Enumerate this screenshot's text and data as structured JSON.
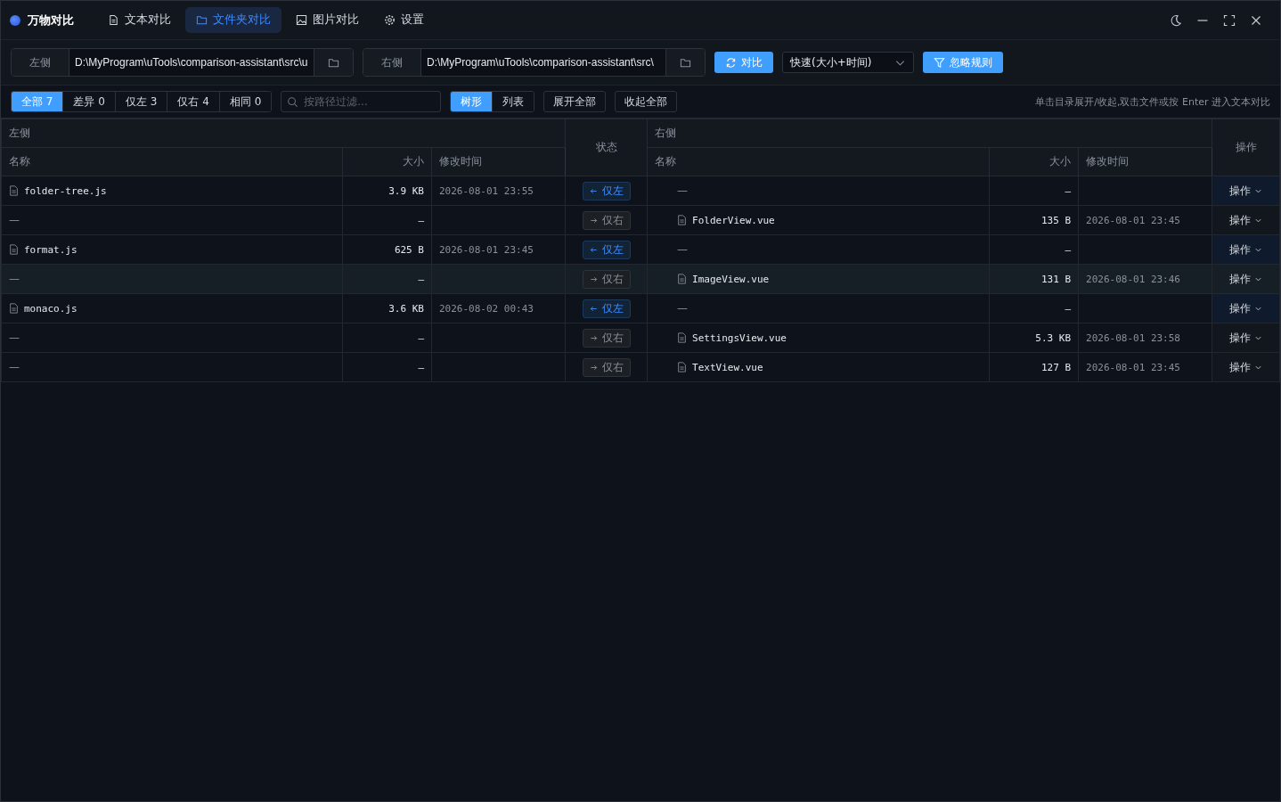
{
  "app": {
    "title": "万物对比"
  },
  "nav": [
    {
      "label": "文本对比",
      "selected": false
    },
    {
      "label": "文件夹对比",
      "selected": true
    },
    {
      "label": "图片对比",
      "selected": false
    },
    {
      "label": "设置",
      "selected": false
    }
  ],
  "paths": [
    {
      "label": "左侧",
      "value": "D:\\MyProgram\\uTools\\comparison-assistant\\src\\u"
    },
    {
      "label": "右侧",
      "value": "D:\\MyProgram\\uTools\\comparison-assistant\\src\\"
    }
  ],
  "compare_button": "对比",
  "mode_select": "快速(大小+时间)",
  "ignore_button": "忽略规则",
  "filters": [
    {
      "label": "全部 7",
      "selected": true
    },
    {
      "label": "差异 0",
      "selected": false
    },
    {
      "label": "仅左 3",
      "selected": false
    },
    {
      "label": "仅右 4",
      "selected": false
    },
    {
      "label": "相同 0",
      "selected": false
    }
  ],
  "search": {
    "placeholder": "按路径过滤..."
  },
  "views": [
    {
      "label": "树形",
      "selected": true
    },
    {
      "label": "列表",
      "selected": false
    }
  ],
  "expand_all": "展开全部",
  "collapse_all": "收起全部",
  "hint": "单击目录展开/收起,双击文件或按 Enter 进入文本对比",
  "table": {
    "left_group": "左侧",
    "right_group": "右侧",
    "status_header": "状态",
    "ops_header": "操作",
    "left_columns": [
      "名称",
      "大小",
      "修改时间"
    ],
    "right_columns": [
      "名称",
      "大小",
      "修改时间"
    ],
    "rows": [
      {
        "left": {
          "name": "folder-tree.js",
          "size": "3.9 KB",
          "time": "2026-08-01 23:55"
        },
        "status": {
          "kind": "left_only",
          "label": "仅左"
        },
        "right": {
          "name": "—",
          "size": "–"
        },
        "ops": "操作",
        "highlighted": false
      },
      {
        "left": {
          "name": "—",
          "size": "–"
        },
        "status": {
          "kind": "right_only",
          "label": "仅右"
        },
        "right": {
          "name": "FolderView.vue",
          "size": "135 B",
          "time": "2026-08-01 23:45"
        },
        "ops": "操作",
        "highlighted": false
      },
      {
        "left": {
          "name": "format.js",
          "size": "625 B",
          "time": "2026-08-01 23:45"
        },
        "status": {
          "kind": "left_only",
          "label": "仅左"
        },
        "right": {
          "name": "—",
          "size": "–"
        },
        "ops": "操作",
        "highlighted": false
      },
      {
        "left": {
          "name": "—",
          "size": "–"
        },
        "status": {
          "kind": "right_only",
          "label": "仅右"
        },
        "right": {
          "name": "ImageView.vue",
          "size": "131 B",
          "time": "2026-08-01 23:46"
        },
        "ops": "操作",
        "highlighted": true
      },
      {
        "left": {
          "name": "monaco.js",
          "size": "3.6 KB",
          "time": "2026-08-02 00:43"
        },
        "status": {
          "kind": "left_only",
          "label": "仅左"
        },
        "right": {
          "name": "—",
          "size": "–"
        },
        "ops": "操作",
        "highlighted": false
      },
      {
        "left": {
          "name": "—",
          "size": "–"
        },
        "status": {
          "kind": "right_only",
          "label": "仅右"
        },
        "right": {
          "name": "SettingsView.vue",
          "size": "5.3 KB",
          "time": "2026-08-01 23:58"
        },
        "ops": "操作",
        "highlighted": false
      },
      {
        "left": {
          "name": "—",
          "size": "–"
        },
        "status": {
          "kind": "right_only",
          "label": "仅右"
        },
        "right": {
          "name": "TextView.vue",
          "size": "127 B",
          "time": "2026-08-01 23:45"
        },
        "ops": "操作",
        "highlighted": false
      }
    ]
  }
}
